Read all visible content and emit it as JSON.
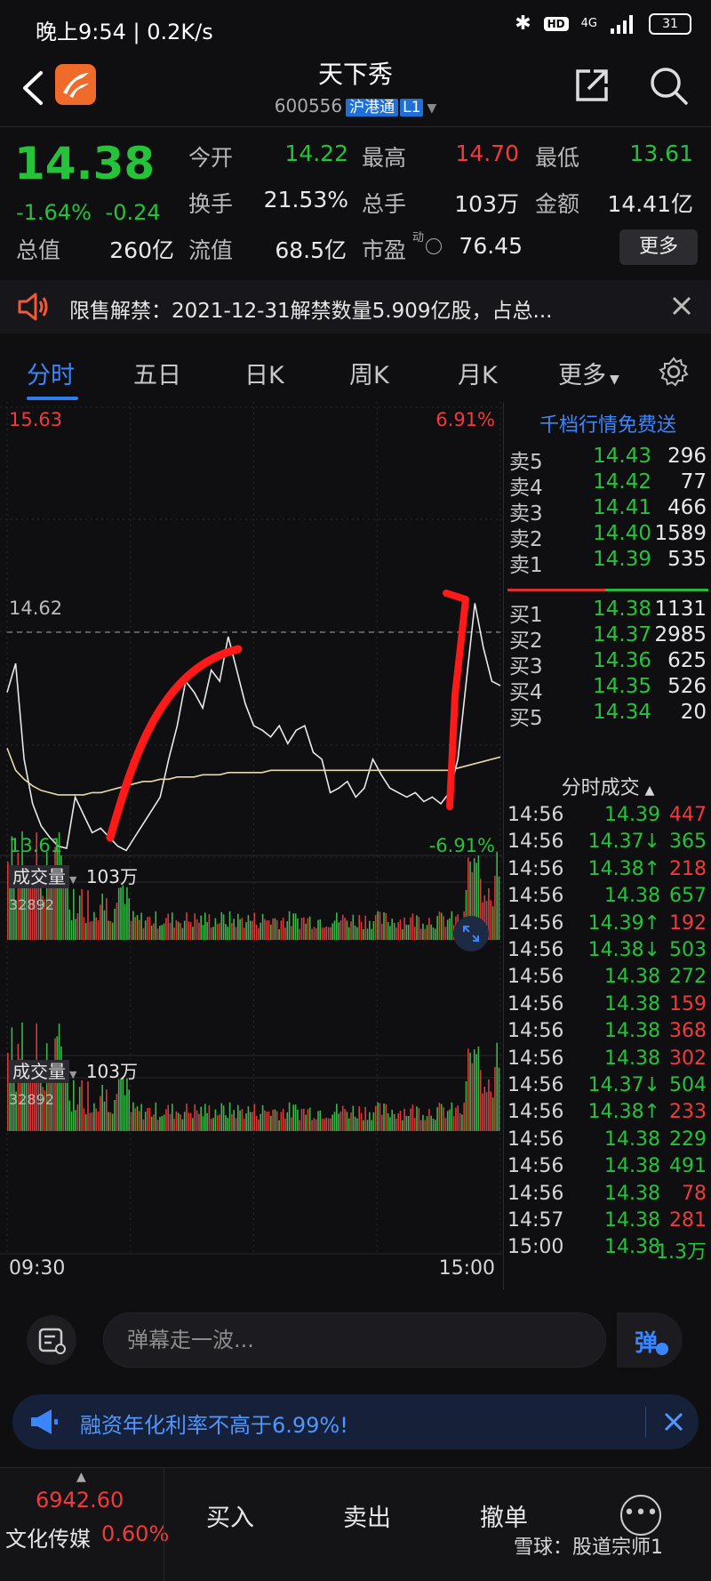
{
  "status_bar": {
    "time": "晚上9:54 | 0.2K/s",
    "network": "4G",
    "battery": "31"
  },
  "header": {
    "title": "天下秀",
    "code": "600556",
    "market_tag": "沪港通",
    "level_tag": "L1"
  },
  "quote": {
    "price": "14.38",
    "change_pct": "-1.64%",
    "change_abs": "-0.24",
    "fields": [
      {
        "label": "今开",
        "value": "14.22",
        "color": "#25c23a"
      },
      {
        "label": "最高",
        "value": "14.70",
        "color": "#f23a3a"
      },
      {
        "label": "最低",
        "value": "13.61",
        "color": "#25c23a"
      },
      {
        "label": "换手",
        "value": "21.53%",
        "color": "#e8e8e8"
      },
      {
        "label": "总手",
        "value": "103万",
        "color": "#e8e8e8"
      },
      {
        "label": "金额",
        "value": "14.41亿",
        "color": "#e8e8e8"
      },
      {
        "label": "总值",
        "value": "260亿",
        "color": "#e8e8e8"
      },
      {
        "label": "流值",
        "value": "68.5亿",
        "color": "#e8e8e8"
      },
      {
        "label": "市盈",
        "value": "76.45",
        "color": "#e8e8e8"
      }
    ],
    "pe_superscript": "动",
    "more_label": "更多"
  },
  "notice": {
    "text": "限售解禁：2021-12-31解禁数量5.909亿股，占总..."
  },
  "tabs": {
    "items": [
      "分时",
      "五日",
      "日K",
      "周K",
      "月K",
      "更多"
    ],
    "active": "分时"
  },
  "chart": {
    "price_high_label": "15.63",
    "price_low_label": "13.61",
    "pct_high_label": "6.91%",
    "pct_low_label": "-6.91%",
    "prev_close_label": "14.62",
    "volume_label": "成交量",
    "volume_value": "103万",
    "volume_max_label": "32892",
    "time_start": "09:30",
    "time_end": "15:00"
  },
  "chart_data": {
    "type": "line",
    "title": "",
    "x": [
      "09:30",
      "15:00"
    ],
    "ylim": [
      13.61,
      15.63
    ],
    "prev_close": 14.62,
    "series": [
      {
        "values": [
          14.35,
          14.48,
          14.05,
          13.85,
          13.75,
          13.7,
          13.66,
          13.65,
          13.88,
          13.8,
          13.72,
          13.74,
          13.7,
          13.66,
          13.64,
          13.7,
          13.76,
          13.82,
          13.88,
          14.05,
          14.2,
          14.4,
          14.35,
          14.28,
          14.45,
          14.4,
          14.6,
          14.45,
          14.3,
          14.2,
          14.18,
          14.15,
          14.2,
          14.12,
          14.18,
          14.2,
          14.08,
          14.05,
          13.9,
          13.92,
          13.95,
          13.88,
          13.92,
          14.05,
          13.98,
          13.92,
          13.9,
          13.88,
          13.9,
          13.86,
          13.88,
          13.85,
          13.9,
          14.05,
          14.4,
          14.75,
          14.55,
          14.4,
          14.38
        ]
      },
      {
        "values": [
          14.1,
          14.0,
          13.96,
          13.93,
          13.91,
          13.9,
          13.89,
          13.89,
          13.89,
          13.89,
          13.9,
          13.9,
          13.91,
          13.92,
          13.93,
          13.94,
          13.95,
          13.95,
          13.96,
          13.96,
          13.97,
          13.97,
          13.97,
          13.98,
          13.98,
          13.98,
          13.99,
          13.99,
          13.99,
          13.99,
          13.99,
          14.0,
          14.0,
          14.0,
          14.0,
          14.0,
          14.0,
          14.0,
          14.0,
          14.0,
          14.0,
          14.0,
          14.0,
          14.0,
          14.0,
          14.0,
          14.0,
          14.0,
          14.0,
          14.0,
          14.0,
          14.0,
          14.0,
          14.01,
          14.02,
          14.03,
          14.04,
          14.05,
          14.06
        ]
      }
    ]
  },
  "orderbook": {
    "header": "千档行情免费送",
    "asks": [
      {
        "label": "卖5",
        "price": "14.43",
        "vol": "296"
      },
      {
        "label": "卖4",
        "price": "14.42",
        "vol": "77"
      },
      {
        "label": "卖3",
        "price": "14.41",
        "vol": "466"
      },
      {
        "label": "卖2",
        "price": "14.40",
        "vol": "1589"
      },
      {
        "label": "卖1",
        "price": "14.39",
        "vol": "535"
      }
    ],
    "bids": [
      {
        "label": "买1",
        "price": "14.38",
        "vol": "1131"
      },
      {
        "label": "买2",
        "price": "14.37",
        "vol": "2985"
      },
      {
        "label": "买3",
        "price": "14.36",
        "vol": "625"
      },
      {
        "label": "买4",
        "price": "14.35",
        "vol": "526"
      },
      {
        "label": "买5",
        "price": "14.34",
        "vol": "20"
      }
    ],
    "trades_header": "分时成交",
    "trades": [
      {
        "t": "14:56",
        "p": "14.39",
        "v": "447",
        "pc": "#25c23a",
        "vc": "#f23a3a"
      },
      {
        "t": "14:56",
        "p": "14.37↓",
        "v": "365",
        "pc": "#25c23a",
        "vc": "#25c23a"
      },
      {
        "t": "14:56",
        "p": "14.38↑",
        "v": "218",
        "pc": "#25c23a",
        "vc": "#f23a3a"
      },
      {
        "t": "14:56",
        "p": "14.38",
        "v": "657",
        "pc": "#25c23a",
        "vc": "#25c23a"
      },
      {
        "t": "14:56",
        "p": "14.39↑",
        "v": "192",
        "pc": "#25c23a",
        "vc": "#f23a3a"
      },
      {
        "t": "14:56",
        "p": "14.38↓",
        "v": "503",
        "pc": "#25c23a",
        "vc": "#25c23a"
      },
      {
        "t": "14:56",
        "p": "14.38",
        "v": "272",
        "pc": "#25c23a",
        "vc": "#25c23a"
      },
      {
        "t": "14:56",
        "p": "14.38",
        "v": "159",
        "pc": "#25c23a",
        "vc": "#f23a3a"
      },
      {
        "t": "14:56",
        "p": "14.38",
        "v": "368",
        "pc": "#25c23a",
        "vc": "#f23a3a"
      },
      {
        "t": "14:56",
        "p": "14.38",
        "v": "302",
        "pc": "#25c23a",
        "vc": "#f23a3a"
      },
      {
        "t": "14:56",
        "p": "14.37↓",
        "v": "504",
        "pc": "#25c23a",
        "vc": "#25c23a"
      },
      {
        "t": "14:56",
        "p": "14.38↑",
        "v": "233",
        "pc": "#25c23a",
        "vc": "#f23a3a"
      },
      {
        "t": "14:56",
        "p": "14.38",
        "v": "229",
        "pc": "#25c23a",
        "vc": "#25c23a"
      },
      {
        "t": "14:56",
        "p": "14.38",
        "v": "491",
        "pc": "#25c23a",
        "vc": "#25c23a"
      },
      {
        "t": "14:56",
        "p": "14.38",
        "v": "78",
        "pc": "#25c23a",
        "vc": "#f23a3a"
      },
      {
        "t": "14:57",
        "p": "14.38",
        "v": "281",
        "pc": "#25c23a",
        "vc": "#f23a3a"
      },
      {
        "t": "15:00",
        "p": "14.38",
        "v": "1.3万",
        "pc": "#25c23a",
        "vc": "#25c23a"
      }
    ]
  },
  "danmaku": {
    "placeholder": "弹幕走一波...",
    "send_label": "弹"
  },
  "promo": {
    "text": "融资年化利率不高于6.99%!"
  },
  "bottom_bar": {
    "index_value": "6942.60",
    "index_name": "文化传媒",
    "index_change": "0.60%",
    "buy_label": "买入",
    "sell_label": "卖出",
    "cancel_label": "撤单"
  },
  "watermark": "雪球：股道宗师1",
  "colors": {
    "up": "#f23a3a",
    "down": "#25c23a",
    "accent": "#2f7bf0",
    "background": "#0f0f12"
  }
}
